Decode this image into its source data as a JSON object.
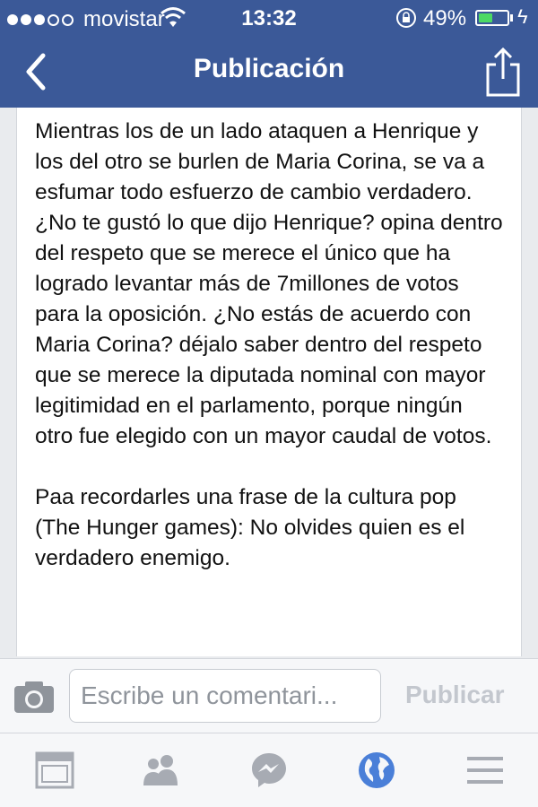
{
  "status_bar": {
    "carrier": "movistar",
    "time": "13:32",
    "battery": "49%",
    "battery_level": 0.49,
    "signal_dots_filled": 3,
    "signal_dots_total": 5,
    "icons": [
      "wifi-icon",
      "orientation-lock-icon",
      "battery-icon",
      "charging-icon"
    ]
  },
  "nav": {
    "title": "Publicación",
    "back_icon": "back-chevron-icon",
    "share_icon": "share-icon"
  },
  "post": {
    "paragraphs": [
      "Mientras los de un lado ataquen a Henrique y los del otro se burlen de Maria Corina, se va a esfumar todo esfuerzo de cambio verdadero. ¿No te gustó lo que dijo Henrique? opina dentro del respeto que se merece el único que ha logrado levantar más de 7millones de votos para la oposición. ¿No estás de acuerdo con Maria Corina? déjalo saber dentro del respeto que se merece la diputada nominal con mayor legitimidad en el parlamento, porque ningún otro fue elegido con un mayor caudal de votos.",
      "Paa recordarles una frase de la cultura pop (The Hunger games): No olvides quien es el verdadero enemigo."
    ]
  },
  "comment": {
    "placeholder": "Escribe un comentari...",
    "value": "",
    "publish_label": "Publicar",
    "camera_icon": "camera-icon"
  },
  "tabs": [
    {
      "icon": "news-feed-icon",
      "active": false
    },
    {
      "icon": "friend-requests-icon",
      "active": false
    },
    {
      "icon": "messenger-icon",
      "active": false
    },
    {
      "icon": "notifications-globe-icon",
      "active": true
    },
    {
      "icon": "more-menu-icon",
      "active": false
    }
  ],
  "colors": {
    "brand": "#3b5998",
    "active_tab": "#4a7fd8",
    "inactive_tab": "#a7abb3",
    "battery_fill": "#4cd964"
  }
}
